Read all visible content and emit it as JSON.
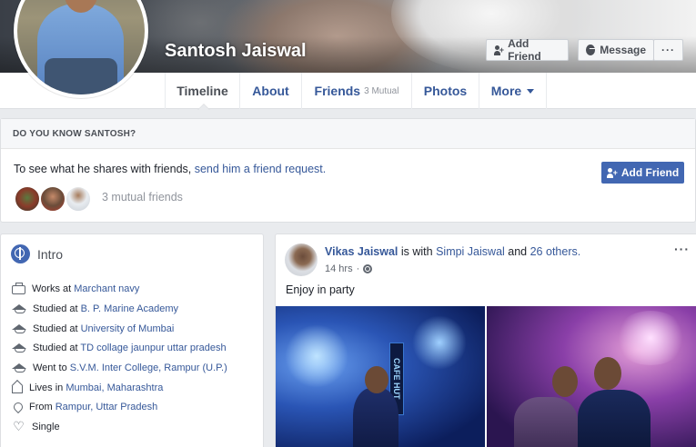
{
  "profile": {
    "name": "Santosh Jaiswal"
  },
  "cover_actions": {
    "add_friend": "Add Friend",
    "message": "Message",
    "more": "···"
  },
  "nav": {
    "timeline": "Timeline",
    "about": "About",
    "friends": "Friends",
    "friends_mutual": "3 Mutual",
    "photos": "Photos",
    "more": "More"
  },
  "know": {
    "header": "DO YOU KNOW SANTOSH?",
    "text_prefix": "To see what he shares with friends, ",
    "text_link": "send him a friend request.",
    "add_friend": "Add Friend",
    "mutual_friends": "3 mutual friends"
  },
  "intro": {
    "title": "Intro",
    "items": [
      {
        "icon": "briefcase-icon",
        "prefix": "Works at ",
        "value": "Marchant navy"
      },
      {
        "icon": "graduation-cap-icon",
        "prefix": "Studied at ",
        "value": "B. P. Marine Academy"
      },
      {
        "icon": "graduation-cap-icon",
        "prefix": "Studied at ",
        "value": "University of Mumbai"
      },
      {
        "icon": "graduation-cap-icon",
        "prefix": "Studied at ",
        "value": "TD collage jaunpur uttar pradesh"
      },
      {
        "icon": "graduation-cap-icon",
        "prefix": "Went to ",
        "value": "S.V.M. Inter College, Rampur (U.P.)"
      },
      {
        "icon": "home-icon",
        "prefix": "Lives in ",
        "value": "Mumbai, Maharashtra"
      },
      {
        "icon": "location-pin-icon",
        "prefix": "From ",
        "value": "Rampur, Uttar Pradesh"
      },
      {
        "icon": "heart-icon",
        "prefix": "Single",
        "value": ""
      }
    ]
  },
  "post": {
    "author": "Vikas Jaiswal",
    "with_text": " is with ",
    "tagged": "Simpi Jaiswal",
    "and_text": " and ",
    "others": "26 others.",
    "time": "14 hrs",
    "separator": "·",
    "menu": "···",
    "text": "Enjoy in party",
    "photo_sign": "CAFE HUT"
  }
}
